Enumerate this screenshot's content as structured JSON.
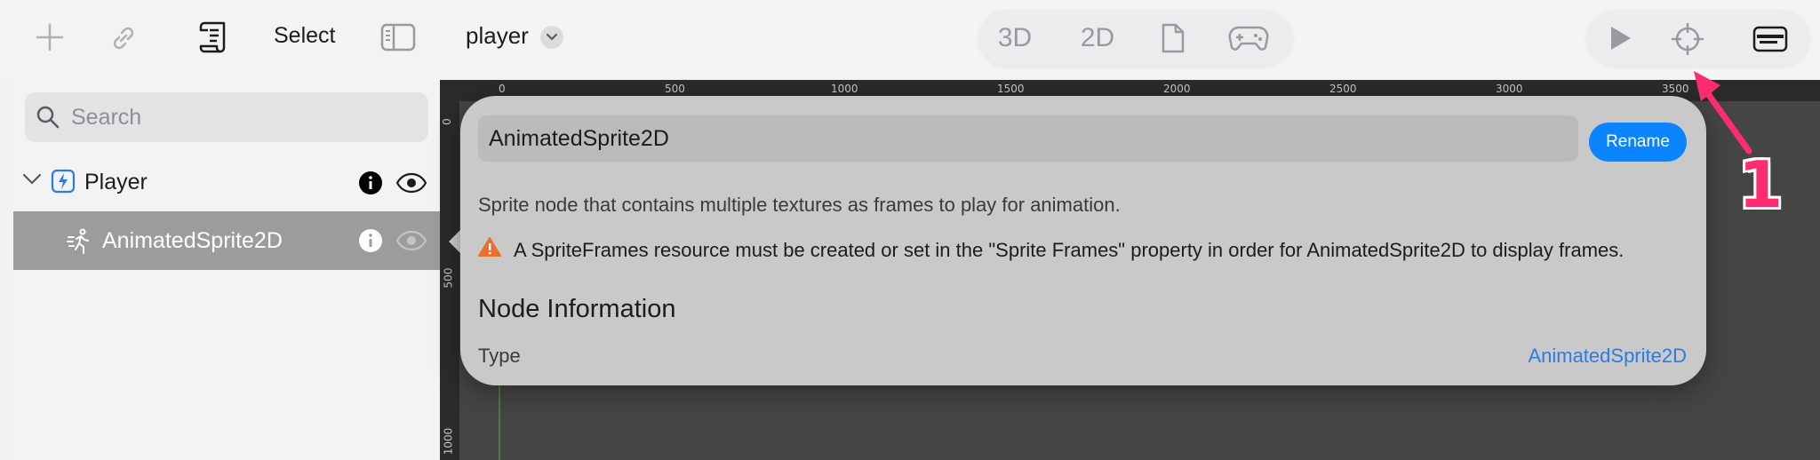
{
  "toolbar": {
    "select_label": "Select",
    "scene_name": "player",
    "modes": [
      "3D",
      "2D"
    ]
  },
  "search": {
    "placeholder": "Search",
    "value": ""
  },
  "scene_tree": {
    "nodes": [
      {
        "label": "Player",
        "icon": "lightning-icon",
        "selected": false
      },
      {
        "label": "AnimatedSprite2D",
        "icon": "running-figure-icon",
        "selected": true
      }
    ]
  },
  "ruler": {
    "top_ticks": [
      "0",
      "500",
      "1000",
      "1500",
      "2000",
      "2500",
      "3000",
      "3500"
    ],
    "left_ticks": [
      "0",
      "500",
      "1000"
    ]
  },
  "popover": {
    "name_value": "AnimatedSprite2D",
    "rename_label": "Rename",
    "description": "Sprite node that contains multiple textures as frames to play for animation.",
    "warning": "A SpriteFrames resource must be created or set in the \"Sprite Frames\" property in order for AnimatedSprite2D to display frames.",
    "section_title": "Node Information",
    "type_label": "Type",
    "type_value": "AnimatedSprite2D"
  },
  "annotation": {
    "number": "1"
  },
  "colors": {
    "accent": "#0a84ff",
    "link": "#2c7be5",
    "annotation": "#ff2d6f",
    "warning": "#e8702a",
    "viewport": "#454545"
  }
}
